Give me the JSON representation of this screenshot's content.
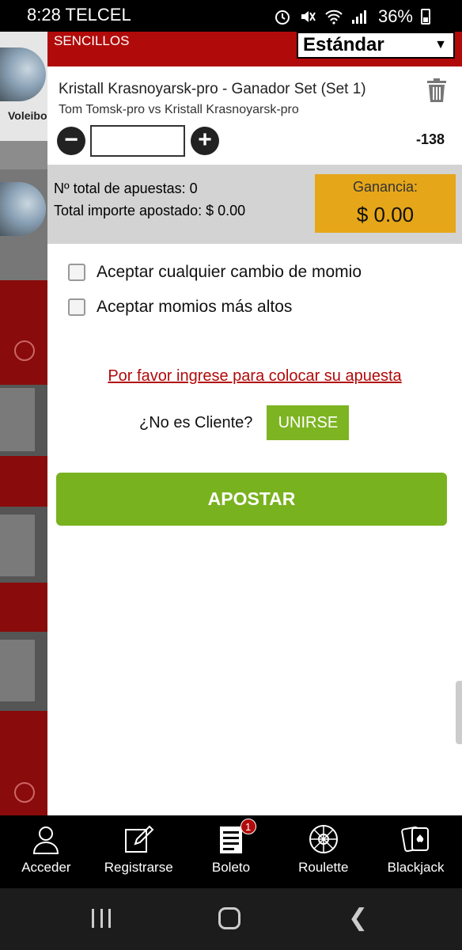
{
  "status": {
    "time": "8:28",
    "carrier": "TELCEL",
    "battery": "36%"
  },
  "sidebar": {
    "sport_label": "Voleibo"
  },
  "header": {
    "section": "SENCILLOS",
    "bet_type": "Estándar"
  },
  "bet": {
    "market": "Kristall Krasnoyarsk-pro - Ganador Set (Set 1)",
    "event": "Tom Tomsk-pro vs Kristall Krasnoyarsk-pro",
    "stake": "",
    "odds": "-138"
  },
  "summary": {
    "total_bets": "Nº total de apuestas: 0",
    "total_staked": "Total importe apostado: $ 0.00",
    "gain_label": "Ganancia:",
    "gain_value": "$ 0.00"
  },
  "options": {
    "accept_any_change": "Aceptar cualquier cambio de momio",
    "accept_higher": "Aceptar momios más altos"
  },
  "login": {
    "prompt": "Por favor ingrese para colocar su apuesta",
    "not_client": "¿No es Cliente?",
    "join": "UNIRSE"
  },
  "submit_label": "APOSTAR",
  "bottom_nav": {
    "items": [
      {
        "label": "Acceder",
        "icon": "user-icon"
      },
      {
        "label": "Registrarse",
        "icon": "edit-icon"
      },
      {
        "label": "Boleto",
        "icon": "ticket-icon",
        "badge": "1"
      },
      {
        "label": "Roulette",
        "icon": "roulette-icon"
      },
      {
        "label": "Blackjack",
        "icon": "cards-icon"
      }
    ]
  },
  "colors": {
    "brand_red": "#b10a0a",
    "green": "#7db422",
    "gain_box": "#e6a619"
  }
}
